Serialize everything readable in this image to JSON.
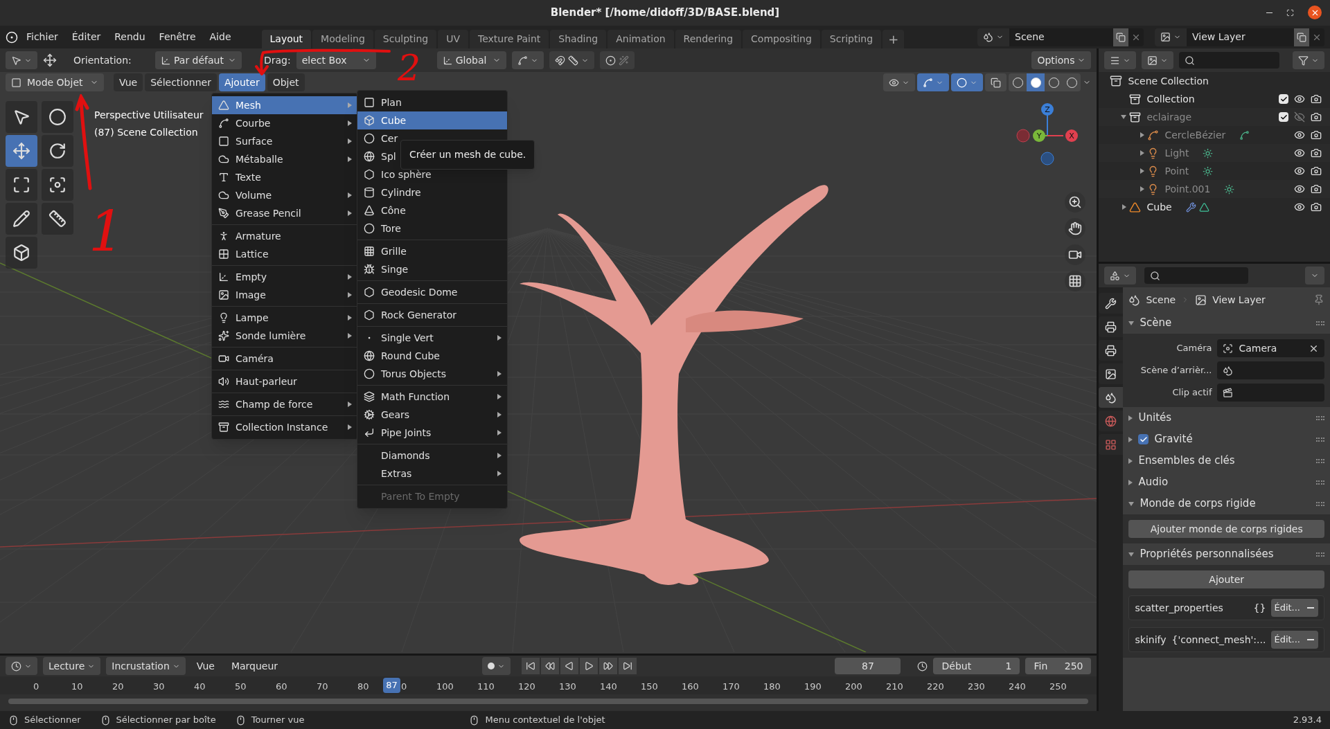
{
  "window": {
    "title": "Blender* [/home/didoff/3D/BASE.blend]"
  },
  "menubar": [
    "Fichier",
    "Éditer",
    "Rendu",
    "Fenêtre",
    "Aide"
  ],
  "workspaces": [
    {
      "label": "Layout",
      "selected": true
    },
    {
      "label": "Modeling",
      "selected": false
    },
    {
      "label": "Sculpting",
      "selected": false
    },
    {
      "label": "UV",
      "selected": false
    },
    {
      "label": "Texture Paint",
      "selected": false
    },
    {
      "label": "Shading",
      "selected": false
    },
    {
      "label": "Animation",
      "selected": false
    },
    {
      "label": "Rendering",
      "selected": false
    },
    {
      "label": "Compositing",
      "selected": false
    },
    {
      "label": "Scripting",
      "selected": false
    }
  ],
  "add_workspace": "+",
  "scene_selector": "Scene",
  "view_layer_selector": "View Layer",
  "tool_settings": {
    "orientation_label": "Orientation:",
    "orientation": "Par défaut",
    "drag_label": "Drag:",
    "drag": "elect Box",
    "transform": "Global",
    "options": "Options",
    "snap": false,
    "proportional": false
  },
  "viewport_header": {
    "mode": "Mode Objet",
    "menus": [
      {
        "label": "Vue",
        "selected": false
      },
      {
        "label": "Sélectionner",
        "selected": false
      },
      {
        "label": "Ajouter",
        "selected": true
      },
      {
        "label": "Objet",
        "selected": false
      }
    ],
    "gizmos": true,
    "overlays": true,
    "shading": [
      {
        "selected": false
      },
      {
        "selected": true
      },
      {
        "selected": false
      },
      {
        "selected": false
      }
    ]
  },
  "viewport_info": [
    "Perspective Utilisateur",
    "(87) Scene Collection"
  ],
  "gizmo_axes": [
    "Z",
    "Y",
    "X"
  ],
  "add_menu": {
    "groups": [
      [
        {
          "label": "Mesh",
          "submenu": true,
          "selected": true
        },
        {
          "label": "Courbe",
          "submenu": true,
          "selected": false
        },
        {
          "label": "Surface",
          "submenu": true,
          "selected": false
        },
        {
          "label": "Métaballe",
          "submenu": true,
          "selected": false
        },
        {
          "label": "Texte",
          "submenu": false,
          "selected": false
        },
        {
          "label": "Volume",
          "submenu": true,
          "selected": false
        },
        {
          "label": "Grease Pencil",
          "submenu": true,
          "selected": false
        }
      ],
      [
        {
          "label": "Armature",
          "submenu": false,
          "selected": false
        },
        {
          "label": "Lattice",
          "submenu": false,
          "selected": false
        }
      ],
      [
        {
          "label": "Empty",
          "submenu": true,
          "selected": false
        },
        {
          "label": "Image",
          "submenu": true,
          "selected": false
        }
      ],
      [
        {
          "label": "Lampe",
          "submenu": true,
          "selected": false
        },
        {
          "label": "Sonde lumière",
          "submenu": true,
          "selected": false
        }
      ],
      [
        {
          "label": "Caméra",
          "submenu": false,
          "selected": false
        }
      ],
      [
        {
          "label": "Haut-parleur",
          "submenu": false,
          "selected": false
        }
      ],
      [
        {
          "label": "Champ de force",
          "submenu": true,
          "selected": false
        }
      ],
      [
        {
          "label": "Collection Instance",
          "submenu": true,
          "selected": false
        }
      ]
    ]
  },
  "mesh_menu": {
    "groups": [
      [
        {
          "label": "Plan",
          "submenu": false,
          "selected": false,
          "disabled": false
        },
        {
          "label": "Cube",
          "submenu": false,
          "selected": true,
          "disabled": false
        },
        {
          "label": "Cer",
          "selected": false,
          "disabled": false
        },
        {
          "label": "Spl",
          "selected": false,
          "disabled": false
        },
        {
          "label": "Ico sphère",
          "submenu": false,
          "selected": false,
          "disabled": false
        },
        {
          "label": "Cylindre",
          "submenu": false,
          "selected": false,
          "disabled": false
        },
        {
          "label": "Cône",
          "submenu": false,
          "selected": false,
          "disabled": false
        },
        {
          "label": "Tore",
          "submenu": false,
          "selected": false,
          "disabled": false
        }
      ],
      [
        {
          "label": "Grille",
          "submenu": false,
          "selected": false,
          "disabled": false
        },
        {
          "label": "Singe",
          "submenu": false,
          "selected": false,
          "disabled": false
        }
      ],
      [
        {
          "label": "Geodesic Dome",
          "submenu": false,
          "selected": false,
          "disabled": false
        }
      ],
      [
        {
          "label": "Rock Generator",
          "submenu": false,
          "selected": false,
          "disabled": false
        }
      ],
      [
        {
          "label": "Single Vert",
          "submenu": true,
          "selected": false,
          "disabled": false
        },
        {
          "label": "Round Cube",
          "submenu": false,
          "selected": false,
          "disabled": false
        },
        {
          "label": "Torus Objects",
          "submenu": true,
          "selected": false,
          "disabled": false
        }
      ],
      [
        {
          "label": "Math Function",
          "submenu": true,
          "selected": false,
          "disabled": false
        },
        {
          "label": "Gears",
          "submenu": true,
          "selected": false,
          "disabled": false
        },
        {
          "label": "Pipe Joints",
          "submenu": true,
          "selected": false,
          "disabled": false
        }
      ],
      [
        {
          "label": "Diamonds",
          "submenu": true,
          "selected": false,
          "disabled": false
        },
        {
          "label": "Extras",
          "submenu": true,
          "selected": false,
          "disabled": false
        }
      ],
      [
        {
          "label": "Parent To Empty",
          "submenu": false,
          "selected": false,
          "disabled": true
        }
      ]
    ]
  },
  "tooltip": "Créer un mesh de cube.",
  "annotations": [
    "1",
    "2"
  ],
  "outliner": {
    "root": {
      "name": "Scene Collection",
      "children": [
        {
          "name": "Collection",
          "kind": "collection",
          "checked": true,
          "visible": true,
          "dimmed": false
        },
        {
          "name": "eclairage",
          "kind": "collection",
          "checked": true,
          "visible": false,
          "dimmed": true,
          "expanded": true,
          "children": [
            {
              "name": "CercleBézier",
              "kind": "curve",
              "visible": true,
              "dimmed": true,
              "expanded": false
            },
            {
              "name": "Light",
              "kind": "light",
              "visible": true,
              "dimmed": true,
              "expanded": false
            },
            {
              "name": "Point",
              "kind": "light",
              "visible": true,
              "dimmed": true,
              "expanded": false
            },
            {
              "name": "Point.001",
              "kind": "light",
              "visible": true,
              "dimmed": true,
              "expanded": false
            }
          ]
        },
        {
          "name": "Cube",
          "kind": "mesh",
          "visible": true,
          "dimmed": false,
          "expanded": false
        }
      ]
    }
  },
  "properties": {
    "tabs": [
      {
        "selected": false
      },
      {
        "selected": false
      },
      {
        "selected": false
      },
      {
        "selected": false
      },
      {
        "selected": true
      },
      {
        "selected": false
      },
      {
        "selected": false
      }
    ],
    "breadcrumb": [
      "Scene",
      "View Layer"
    ],
    "sections": [
      {
        "kind": "fields",
        "title": "Scène",
        "expanded": true,
        "fields": [
          {
            "label": "Caméra",
            "value": "Camera"
          },
          {
            "label": "Scène d’arrièr..."
          },
          {
            "label": "Clip actif"
          }
        ]
      },
      {
        "kind": "plain",
        "title": "Unités",
        "expanded": false
      },
      {
        "kind": "check",
        "title": "Gravité",
        "expanded": false,
        "checked": true
      },
      {
        "kind": "plain",
        "title": "Ensembles de clés",
        "expanded": false
      },
      {
        "kind": "plain",
        "title": "Audio",
        "expanded": false
      },
      {
        "kind": "button",
        "title": "Monde de corps rigide",
        "expanded": true,
        "button": "Ajouter monde de corps rigides"
      },
      {
        "kind": "custom",
        "title": "Propriétés personnalisées",
        "expanded": true,
        "button": "Ajouter",
        "props": [
          {
            "name": "scatter_properties",
            "value": "{}",
            "edit": "Édit..."
          },
          {
            "name": "skinify",
            "value": "{'connect_mesh':...",
            "edit": "Édit..."
          }
        ]
      }
    ]
  },
  "timeline": {
    "menus": [
      "Lecture",
      "Incrustation"
    ],
    "links": [
      "Vue",
      "Marqueur"
    ],
    "current_frame": "87",
    "start_label": "Début",
    "start": "1",
    "end_label": "Fin",
    "end": "250",
    "ruler": [
      "0",
      "10",
      "20",
      "30",
      "40",
      "50",
      "60",
      "70",
      "80",
      "0",
      "100",
      "110",
      "120",
      "130",
      "140",
      "150",
      "160",
      "170",
      "180",
      "190",
      "200",
      "210",
      "220",
      "230",
      "240",
      "250"
    ],
    "playhead": "87"
  },
  "status_bar": {
    "hints": [
      "Sélectionner",
      "Sélectionner par boîte",
      "Tourner vue",
      "Menu contextuel de l'objet"
    ],
    "version": "2.93.4"
  }
}
